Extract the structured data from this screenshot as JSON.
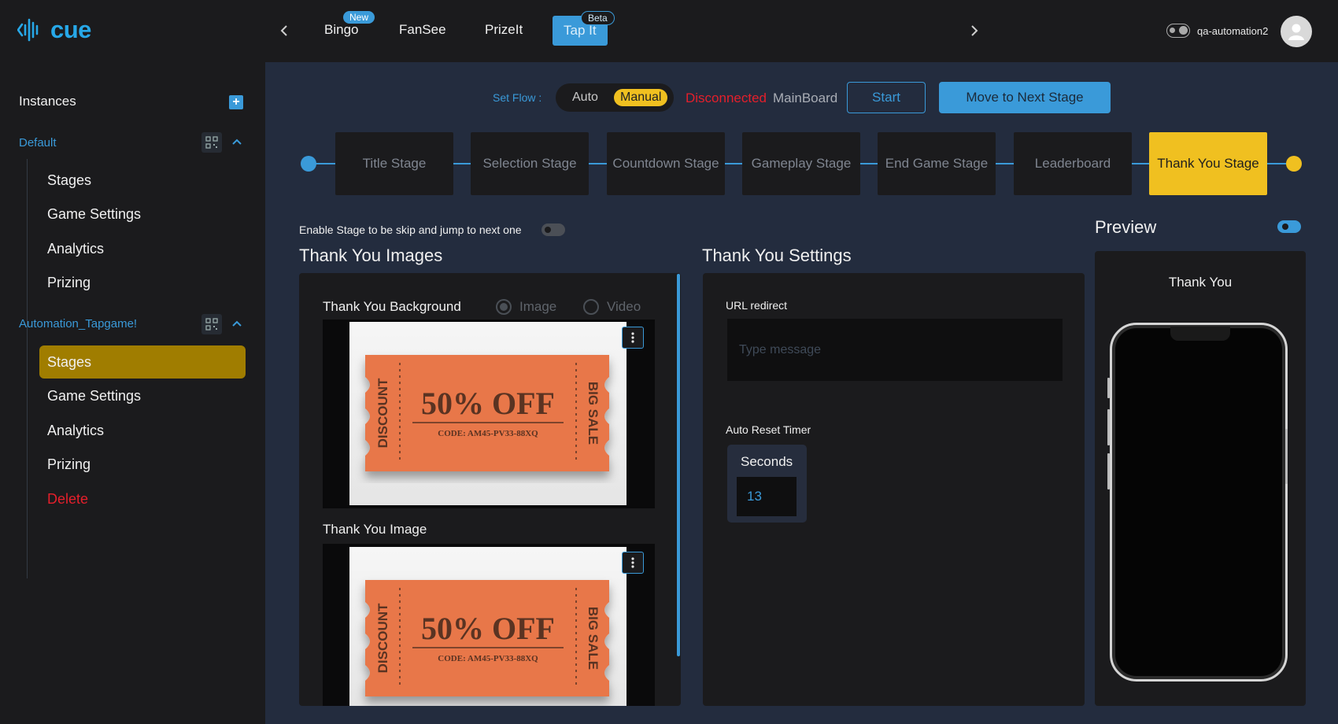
{
  "app": {
    "logo_text": "cue",
    "username": "qa-automation2"
  },
  "colors": {
    "accent": "#3a9ad9",
    "active_stage": "#f0c020",
    "danger": "#e51f2b",
    "active_sidebar": "#a07d00"
  },
  "topnav": {
    "tabs": [
      {
        "label": "Bingo",
        "badge": "New"
      },
      {
        "label": "FanSee"
      },
      {
        "label": "PrizeIt"
      },
      {
        "label": "Tap It",
        "badge": "Beta",
        "active": true
      }
    ]
  },
  "sidebar": {
    "title": "Instances",
    "groups": [
      {
        "name": "Default",
        "items": [
          "Stages",
          "Game Settings",
          "Analytics",
          "Prizing"
        ]
      },
      {
        "name": "Automation_Tapgame!",
        "items": [
          "Stages",
          "Game Settings",
          "Analytics",
          "Prizing",
          "Delete"
        ],
        "active_item": "Stages"
      }
    ]
  },
  "flow": {
    "label": "Set Flow :",
    "options": [
      "Auto",
      "Manual"
    ],
    "selected": "Manual",
    "status": "Disconnected",
    "board": "MainBoard",
    "start_label": "Start",
    "next_label": "Move to Next Stage"
  },
  "stages": [
    "Title Stage",
    "Selection Stage",
    "Countdown Stage",
    "Gameplay Stage",
    "End Game Stage",
    "Leaderboard",
    "Thank You Stage"
  ],
  "active_stage": "Thank You Stage",
  "skip": {
    "label": "Enable Stage to be skip and jump to next one",
    "enabled": false
  },
  "images": {
    "title": "Thank You Images",
    "background_label": "Thank You Background",
    "media_options": [
      "Image",
      "Video"
    ],
    "media_selected": "Image",
    "image_label": "Thank You Image",
    "ticket": {
      "left": "DISCOUNT",
      "main": "50% OFF",
      "code": "CODE: AM45-PV33-88XQ",
      "right": "BIG SALE"
    }
  },
  "settings": {
    "title": "Thank You Settings",
    "url_label": "URL redirect",
    "url_value": "",
    "url_placeholder": "Type message",
    "timer_label": "Auto Reset Timer",
    "seconds_label": "Seconds",
    "seconds_value": "13"
  },
  "preview": {
    "title": "Preview",
    "enabled": true,
    "text": "Thank You"
  }
}
